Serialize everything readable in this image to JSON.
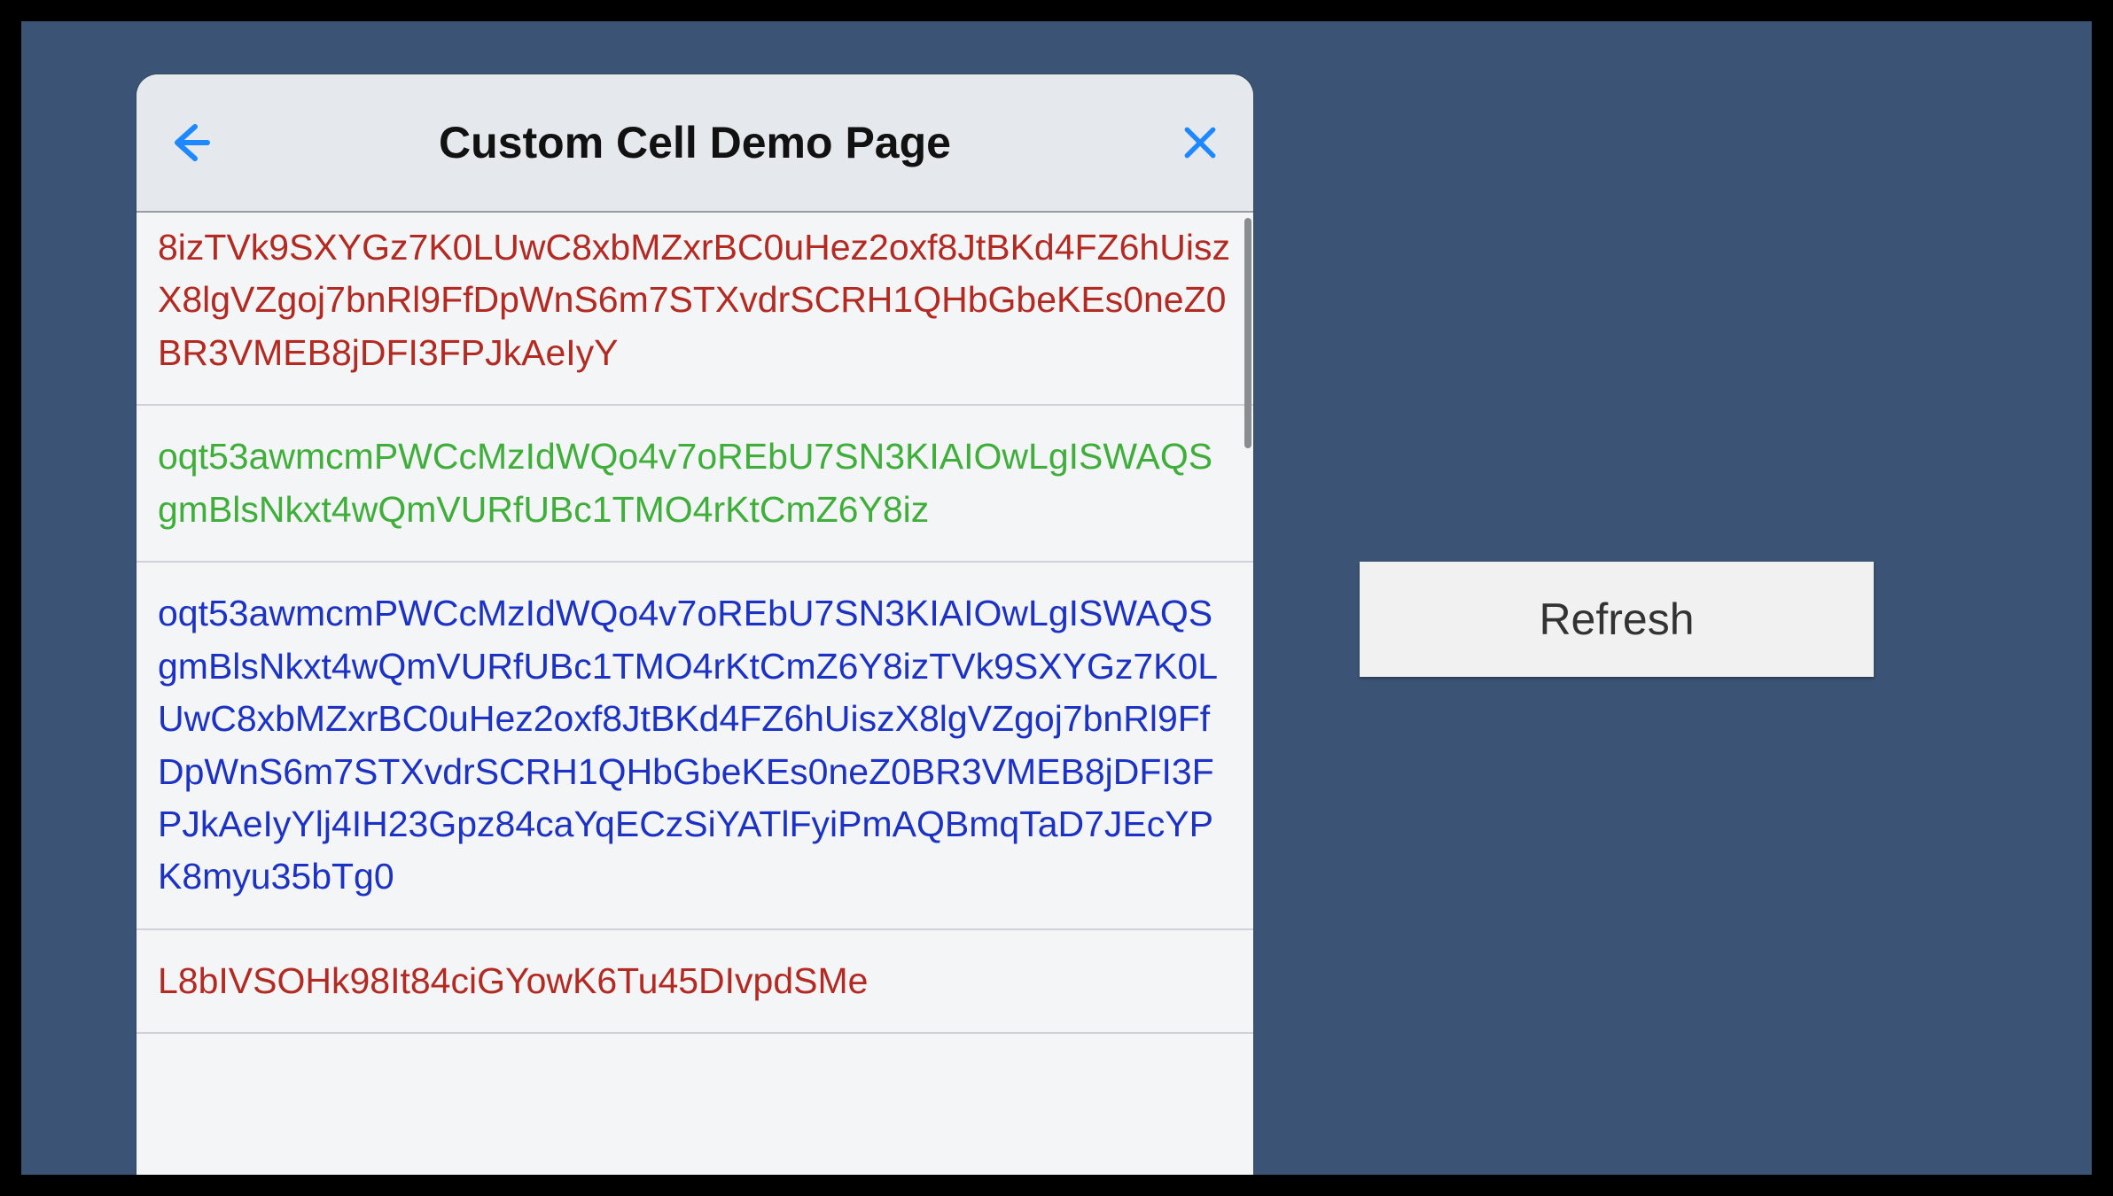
{
  "nav": {
    "title": "Custom Cell Demo Page"
  },
  "refresh": {
    "label": "Refresh"
  },
  "cells": [
    {
      "color": "red",
      "text": "8izTVk9SXYGz7K0LUwC8xbMZxrBC0uHez2oxf8JtBKd4FZ6hUiszX8lgVZgoj7bnRl9FfDpWnS6m7STXvdrSCRH1QHbGbeKEs0neZ0BR3VMEB8jDFI3FPJkAeIyY"
    },
    {
      "color": "green",
      "text": "oqt53awmcmPWCcMzIdWQo4v7oREbU7SN3KIAIOwLgISWAQSgmBlsNkxt4wQmVURfUBc1TMO4rKtCmZ6Y8iz"
    },
    {
      "color": "blue",
      "text": "oqt53awmcmPWCcMzIdWQo4v7oREbU7SN3KIAIOwLgISWAQSgmBlsNkxt4wQmVURfUBc1TMO4rKtCmZ6Y8izTVk9SXYGz7K0LUwC8xbMZxrBC0uHez2oxf8JtBKd4FZ6hUiszX8lgVZgoj7bnRl9FfDpWnS6m7STXvdrSCRH1QHbGbeKEs0neZ0BR3VMEB8jDFI3FPJkAeIyYlj4IH23Gpz84caYqECzSiYATlFyiPmAQBmqTaD7JEcYPK8myu35bTg0"
    },
    {
      "color": "red",
      "text": "L8bIVSOHk98It84ciGYowK6Tu45DIvpdSMe"
    }
  ]
}
